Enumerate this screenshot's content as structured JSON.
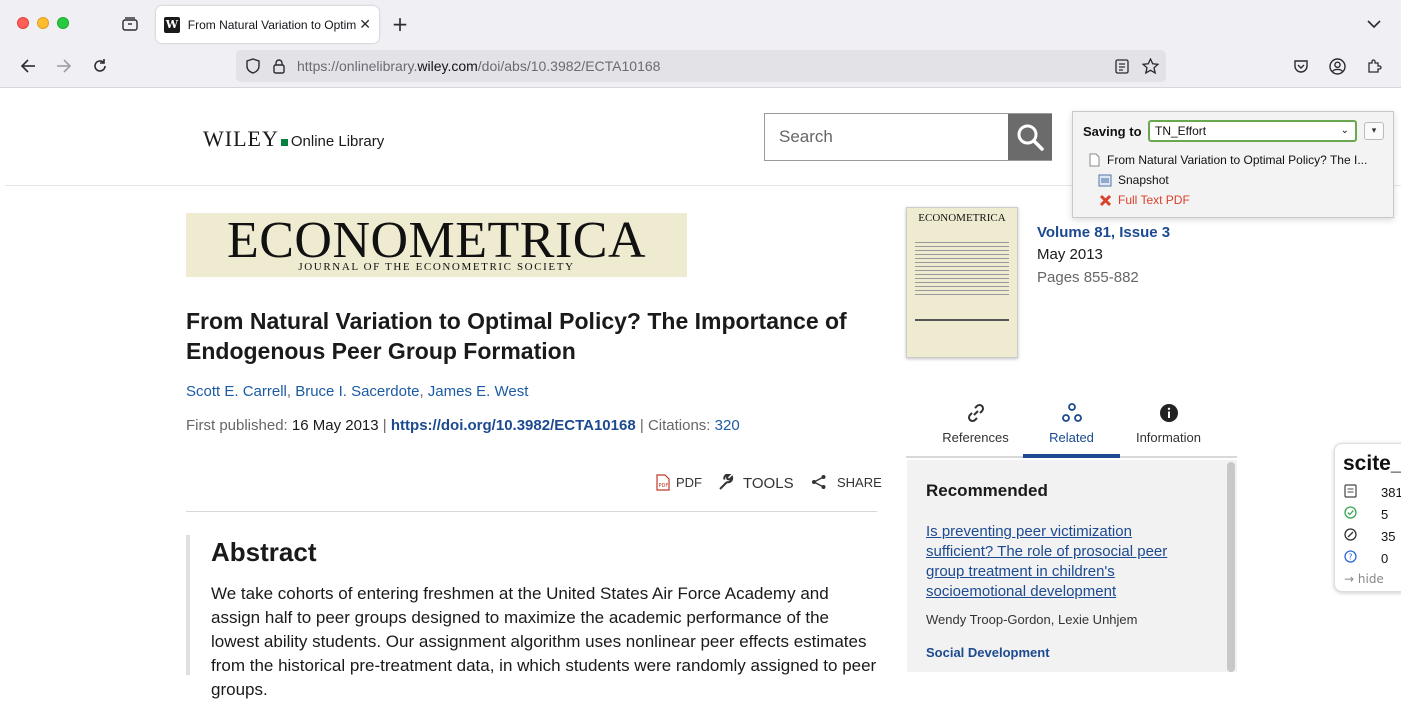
{
  "browser": {
    "tab_title": "From Natural Variation to Optim",
    "tab_favicon": "W",
    "new_tab": "+",
    "url_prefix": "https://onlinelibrary.",
    "url_domain": "wiley.com",
    "url_path": "/doi/abs/10.3982/ECTA10168"
  },
  "header": {
    "logo_main": "WILEY",
    "logo_sub": "Online Library",
    "search_placeholder": "Search"
  },
  "journal": {
    "name": "ECONOMETRICA",
    "subtitle": "JOURNAL OF THE ECONOMETRIC SOCIETY"
  },
  "article": {
    "title": "From Natural Variation to Optimal Policy? The Importance of Endogenous Peer Group Formation",
    "authors": [
      "Scott E. Carrell",
      "Bruce I. Sacerdote",
      "James E. West"
    ],
    "first_published_label": "First published:",
    "first_published": "16 May 2013",
    "doi": "https://doi.org/10.3982/ECTA10168",
    "citations_label": "Citations:",
    "citations": "320"
  },
  "actions": {
    "pdf": "PDF",
    "tools": "TOOLS",
    "share": "SHARE"
  },
  "abstract": {
    "heading": "Abstract",
    "text": "We take cohorts of entering freshmen at the United States Air Force Academy and assign half to peer groups designed to maximize the academic performance of the lowest ability students. Our assignment algorithm uses nonlinear peer effects estimates from the historical pre-treatment data, in which students were randomly assigned to peer groups."
  },
  "issue": {
    "cover_title": "ECONOMETRICA",
    "volume": "Volume 81, Issue 3",
    "date": "May 2013",
    "pages": "Pages 855-882"
  },
  "side_tabs": [
    {
      "label": "References",
      "icon": "link-icon"
    },
    {
      "label": "Related",
      "icon": "related-icon"
    },
    {
      "label": "Information",
      "icon": "info-icon"
    }
  ],
  "recommended": {
    "heading": "Recommended",
    "item_title": "Is preventing peer victimization sufficient? The role of prosocial peer group treatment in children's socioemotional development",
    "item_authors": "Wendy Troop-Gordon, Lexie Unhjem",
    "item_journal": "Social Development"
  },
  "zotero": {
    "saving_to_label": "Saving to",
    "collection": "TN_Effort",
    "item_title": "From Natural Variation to Optimal Policy? The I...",
    "attachment1": "Snapshot",
    "attachment2": "Full Text PDF"
  },
  "scite": {
    "logo": "scite_",
    "counts": [
      "381",
      "5",
      "35",
      "0"
    ],
    "hide": "hide"
  },
  "colors": {
    "link": "#1c4a90",
    "banner_bg": "#efebd1",
    "zotero_error": "#d9412b"
  }
}
